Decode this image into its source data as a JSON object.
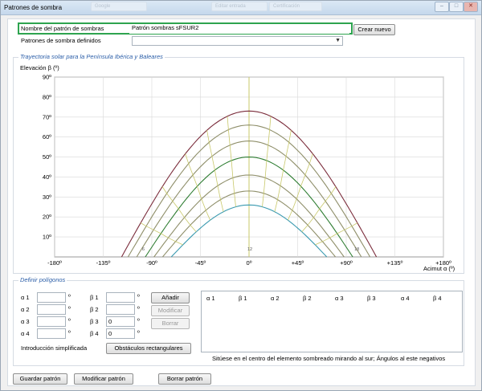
{
  "window": {
    "title": "Patrones de sombra",
    "ghost_tabs": [
      "Google",
      "Editar entrada",
      "Certificación"
    ]
  },
  "header": {
    "pattern_name_label": "Nombre del patrón de sombras",
    "pattern_name_value": "Patrón sombras sFSUR2",
    "create_button": "Crear nuevo",
    "defined_label": "Patrones de sombra definidos"
  },
  "chart": {
    "group_title": "Trayectoria solar para la Península Ibérica y Baleares",
    "ylabel": "Elevación β (º)",
    "xlabel": "Acimut α (º)"
  },
  "chart_data": {
    "type": "line",
    "title": "",
    "xlabel": "Acimut α (º)",
    "ylabel": "Elevación β (º)",
    "xlim": [
      -180,
      180
    ],
    "ylim": [
      0,
      90
    ],
    "x_ticks": [
      "-180º",
      "-135º",
      "-90º",
      "-45º",
      "0º",
      "+45º",
      "+90º",
      "+135º",
      "+180º"
    ],
    "y_ticks": [
      "10º",
      "20º",
      "30º",
      "40º",
      "50º",
      "60º",
      "70º",
      "80º",
      "90º"
    ],
    "hour_labels": [
      "6",
      "12",
      "18"
    ],
    "sun_paths": [
      {
        "max_elev": 73,
        "half_width": 118,
        "color": "#7a2b3a"
      },
      {
        "max_elev": 66,
        "half_width": 112,
        "color": "#8f8f6a"
      },
      {
        "max_elev": 58,
        "half_width": 104,
        "color": "#8f8f6a"
      },
      {
        "max_elev": 50,
        "half_width": 96,
        "color": "#2e7d32"
      },
      {
        "max_elev": 41,
        "half_width": 88,
        "color": "#8f8f6a"
      },
      {
        "max_elev": 33,
        "half_width": 80,
        "color": "#8f8f6a"
      },
      {
        "max_elev": 26,
        "half_width": 72,
        "color": "#3a9ab0"
      }
    ],
    "grid": true
  },
  "polygons": {
    "group_title": "Definir polígonos",
    "rows": [
      {
        "alpha_label": "α 1",
        "alpha_value": "",
        "beta_label": "β 1",
        "beta_value": ""
      },
      {
        "alpha_label": "α 2",
        "alpha_value": "",
        "beta_label": "β 2",
        "beta_value": ""
      },
      {
        "alpha_label": "α 3",
        "alpha_value": "",
        "beta_label": "β 3",
        "beta_value": "0"
      },
      {
        "alpha_label": "α 4",
        "alpha_value": "",
        "beta_label": "β 4",
        "beta_value": "0"
      }
    ],
    "degree_symbol": "º",
    "add_button": "Añadir",
    "modify_button": "Modificar",
    "delete_button": "Borrar",
    "simplified_label": "Introducción simplificada",
    "rect_button": "Obstáculos rectangulares",
    "grid_headers": [
      "α 1",
      "β 1",
      "α 2",
      "β 2",
      "α 3",
      "β 3",
      "α 4",
      "β 4"
    ],
    "hint": "Sitúese en el centro del elemento sombreado mirando al sur; Ángulos al este negativos"
  },
  "footer": {
    "save_button": "Guardar patrón",
    "modify_button": "Modificar patrón",
    "delete_button": "Borrar patrón"
  }
}
